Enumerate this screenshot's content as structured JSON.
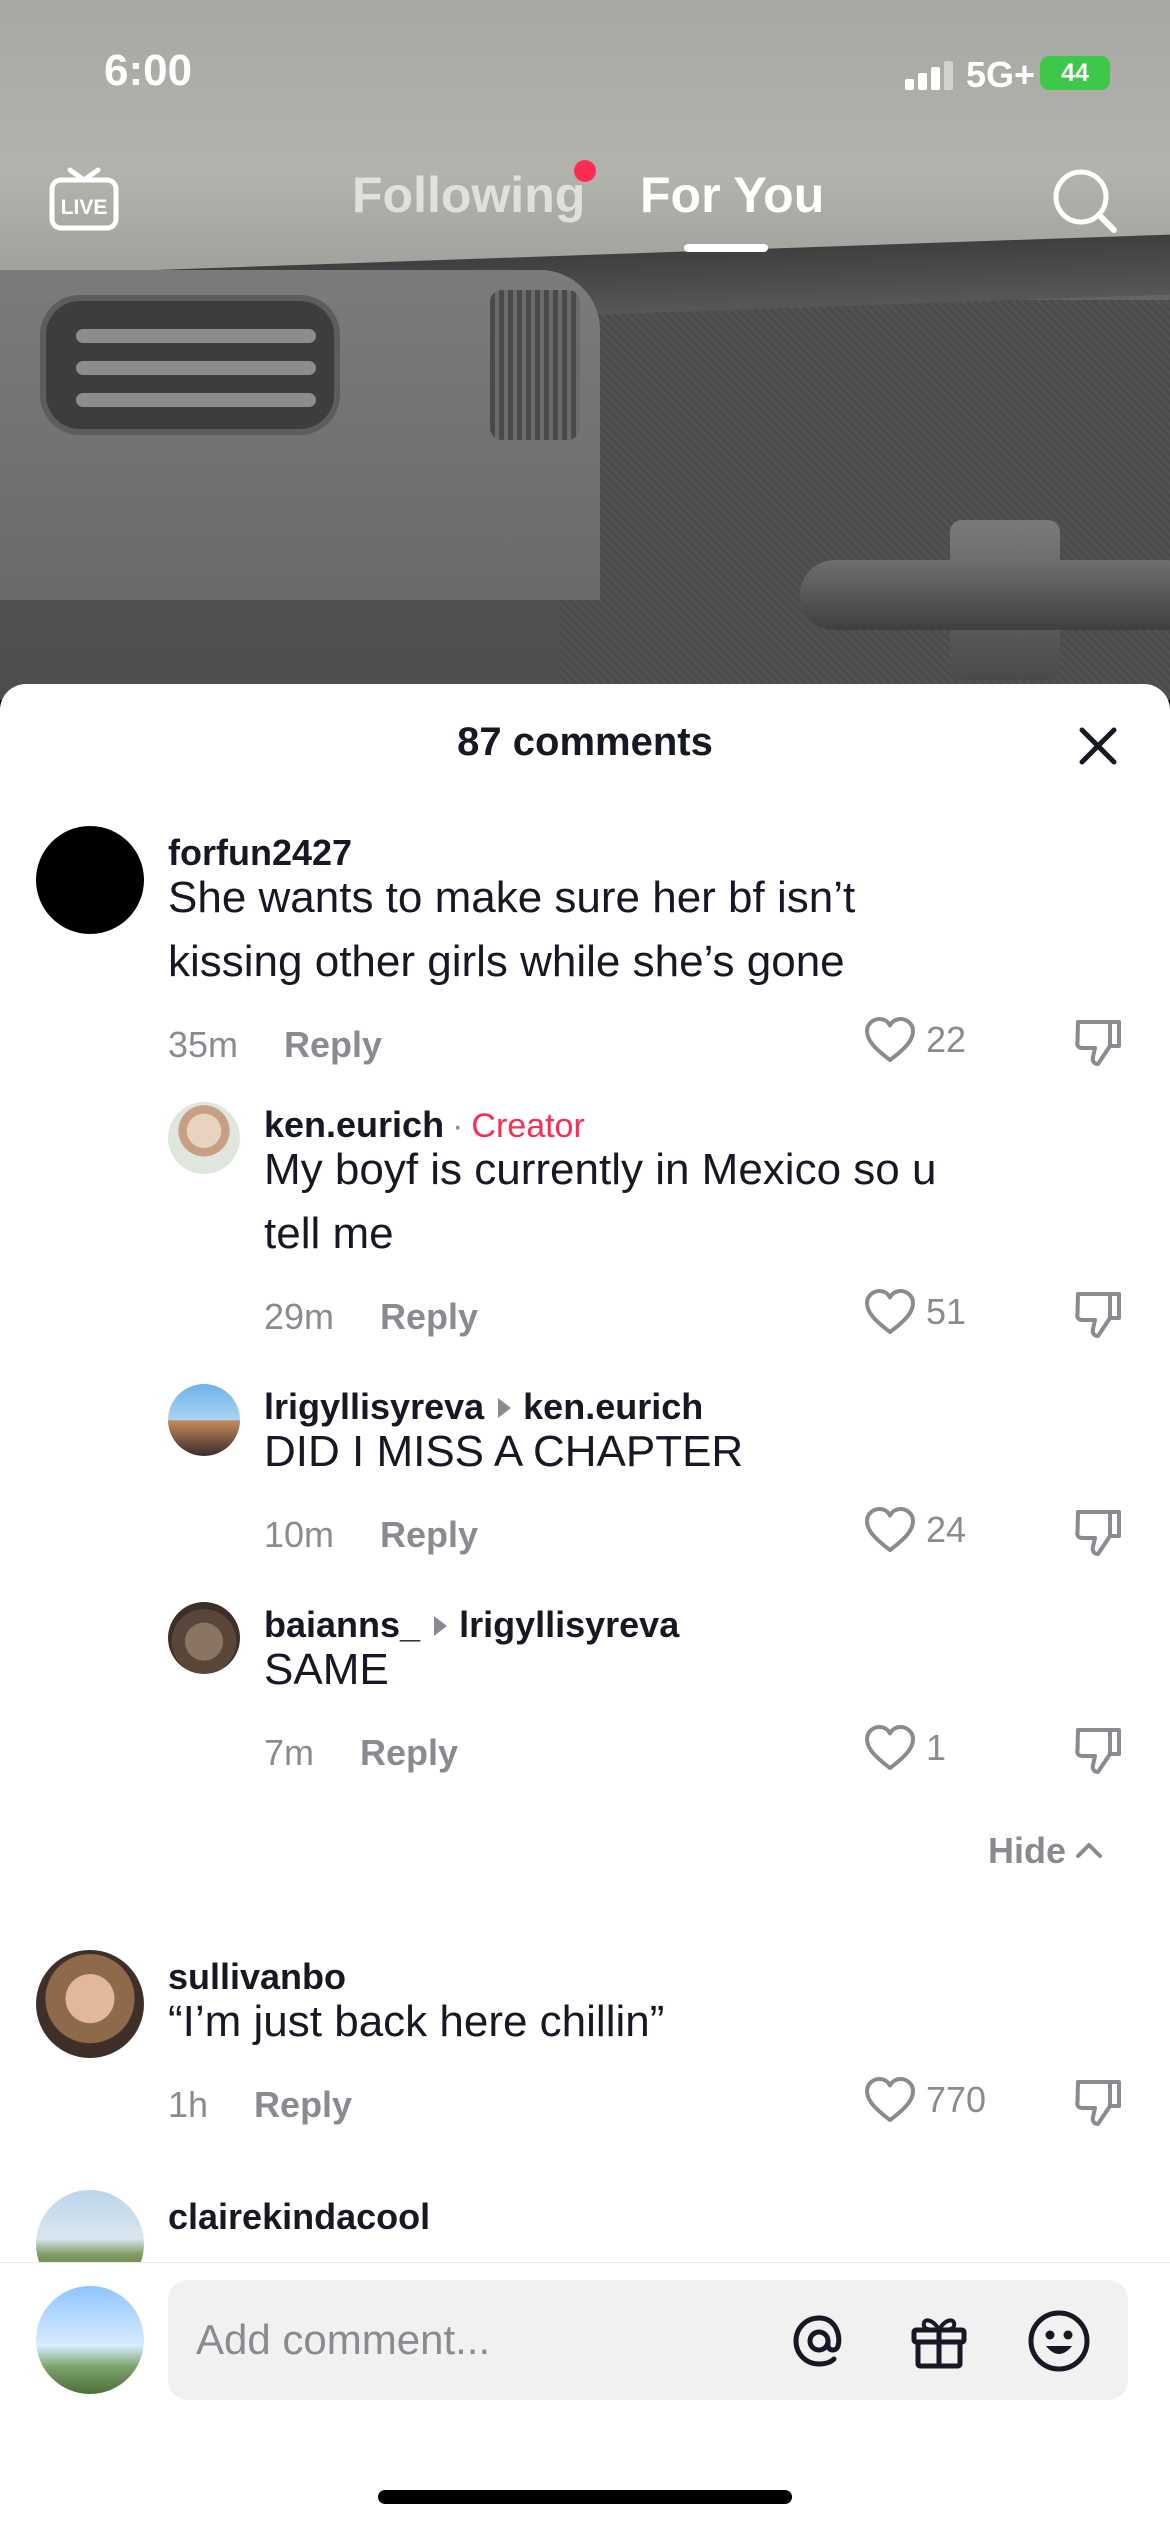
{
  "status_bar": {
    "time": "6:00",
    "network": "5G+",
    "battery": "44"
  },
  "top_nav": {
    "live_label": "LIVE",
    "following_label": "Following",
    "for_you_label": "For You",
    "active_tab": "For You",
    "notification_dot_color": "#fe2c55"
  },
  "comments_sheet": {
    "title": "87 comments",
    "comments": [
      {
        "username": "forfun2427",
        "text": "She wants to make sure her bf isn’t kissing other girls while she’s gone",
        "time": "35m",
        "reply_label": "Reply",
        "likes": "22"
      },
      {
        "username": "ken.eurich",
        "creator_label": "Creator",
        "text": "My boyf is currently in Mexico so u tell me",
        "time": "29m",
        "reply_label": "Reply",
        "likes": "51"
      },
      {
        "username": "lrigyllisyreva",
        "reply_to": "ken.eurich",
        "text": "DID I MISS A CHAPTER",
        "time": "10m",
        "reply_label": "Reply",
        "likes": "24"
      },
      {
        "username": "baianns_",
        "reply_to": "lrigyllisyreva",
        "text": "SAME",
        "time": "7m",
        "reply_label": "Reply",
        "likes": "1"
      },
      {
        "username": "sullivanbo",
        "text": "“I’m just back here chillin”",
        "time": "1h",
        "reply_label": "Reply",
        "likes": "770"
      },
      {
        "username": "clairekindacool"
      }
    ],
    "hide_label": "Hide"
  },
  "input_bar": {
    "placeholder": "Add comment...",
    "icons": [
      "at-icon",
      "gift-icon",
      "emoji-icon"
    ]
  },
  "colors": {
    "accent": "#fe2c55",
    "battery": "#3ec84a",
    "muted_text": "#8a8b91",
    "primary_text": "#161823"
  }
}
